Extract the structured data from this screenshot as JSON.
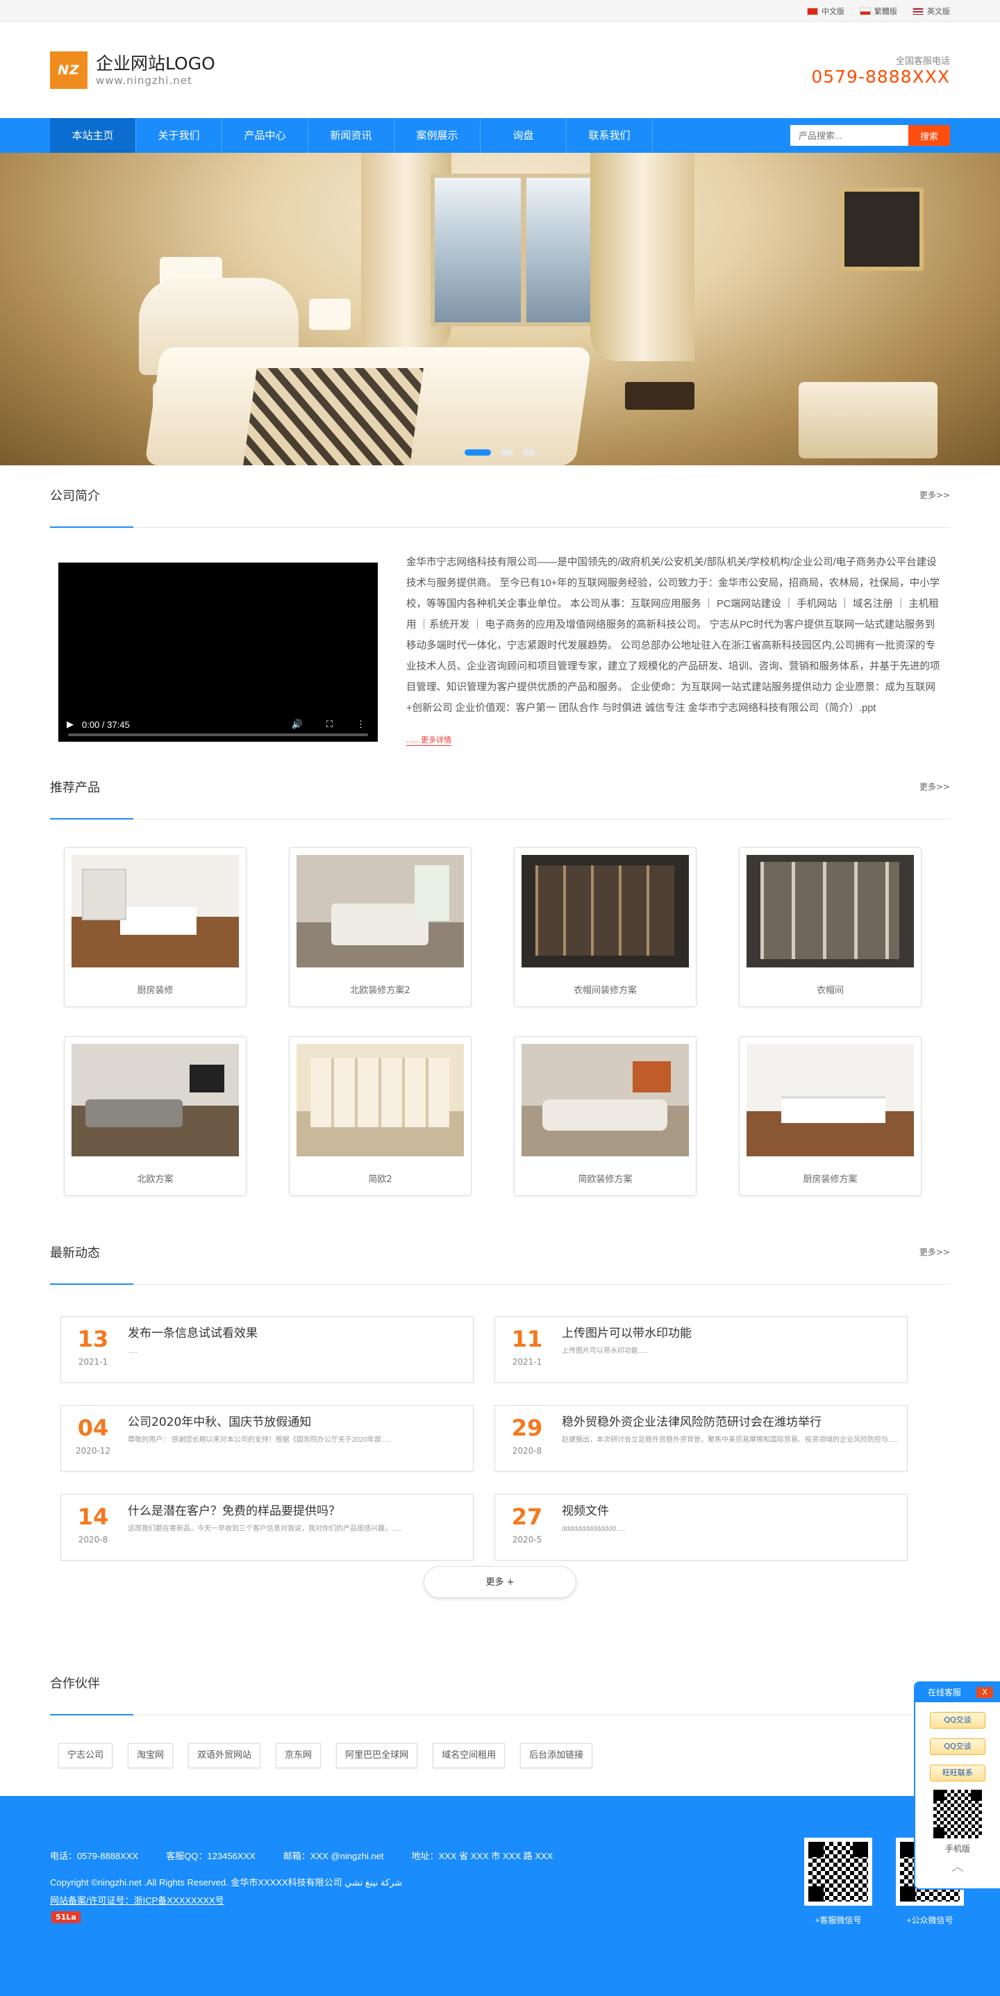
{
  "topbar": {
    "langs": [
      "中文版",
      "繁體版",
      "英文版"
    ]
  },
  "header": {
    "logo_mark": "NZ",
    "logo_title": "企业网站LOGO",
    "logo_sub": "www.ningzhi.net",
    "hotline_label": "全国客服电话",
    "hotline": "0579-8888XXX"
  },
  "nav": {
    "items": [
      "本站主页",
      "关于我们",
      "产品中心",
      "新闻资讯",
      "案例展示",
      "询盘",
      "联系我们"
    ],
    "search_placeholder": "产品搜索...",
    "search_button": "搜索"
  },
  "about": {
    "title": "公司简介",
    "more": "更多>>",
    "video_time": "0:00 / 37:45",
    "text": "金华市宁志网络科技有限公司——是中国领先的/政府机关/公安机关/部队机关/学校机构/企业公司/电子商务办公平台建设技术与服务提供商。 至今已有10+年的互联网服务经验，公司致力于：金华市公安局，招商局，农林局，社保局，中小学校，等等国内各种机关企事业单位。 本公司从事：互联网应用服务 ｜ PC端网站建设 ｜ 手机网站 ｜ 域名注册 ｜ 主机租用 ｜系统开发 ｜ 电子商务的应用及增值网络服务的高新科技公司。 宁志从PC时代为客户提供互联网一站式建站服务到移动多端时代一体化，宁志紧跟时代发展趋势。 公司总部办公地址驻入在浙江省高新科技园区内,公司拥有一批资深的专业技术人员、企业咨询顾问和项目管理专家，建立了规模化的产品研发、培训、咨询、营销和服务体系，并基于先进的项目管理、知识管理为客户提供优质的产品和服务。 企业使命：为互联网一站式建站服务提供动力 企业愿景：成为互联网+创新公司 企业价值观：客户第一 团队合作 与时俱进 诚信专注 金华市宁志网络科技有限公司（简介）.ppt",
    "read_more": "......更多详情"
  },
  "products": {
    "title": "推荐产品",
    "more": "更多>>",
    "items": [
      {
        "name": "厨房装修",
        "img": "kitchen"
      },
      {
        "name": "北欧装修方案2",
        "img": "bed"
      },
      {
        "name": "衣帽间装修方案",
        "img": "closet"
      },
      {
        "name": "衣帽间",
        "img": "closet2"
      },
      {
        "name": "北欧方案",
        "img": "living"
      },
      {
        "name": "简欧2",
        "img": "euro"
      },
      {
        "name": "简欧装修方案",
        "img": "euro2"
      },
      {
        "name": "厨房装修方案",
        "img": "kitchen2"
      }
    ]
  },
  "news": {
    "title": "最新动态",
    "more": "更多>>",
    "more_button": "更多 +",
    "items": [
      {
        "day": "13",
        "ym": "2021-1",
        "title": "发布一条信息试试看效果",
        "desc": "....."
      },
      {
        "day": "11",
        "ym": "2021-1",
        "title": "上传图片可以带水印功能",
        "desc": "上传图片可以带水印功能....."
      },
      {
        "day": "04",
        "ym": "2020-12",
        "title": "公司2020年中秋、国庆节放假通知",
        "desc": "尊敬的用户：        感谢您长期以来对本公司的支持！根据《国务院办公厅关于2020年部....."
      },
      {
        "day": "29",
        "ym": "2020-8",
        "title": "稳外贸稳外资企业法律风险防范研讨会在潍坊举行",
        "desc": "赵健报出，本次研讨会立足稳外贸稳外资背景，聚焦中美贸易摩擦和国际贸易、投资领域的企业风险防控与....."
      },
      {
        "day": "14",
        "ym": "2020-8",
        "title": "什么是潜在客户？免费的样品要提供吗？",
        "desc": "这周我们都在寄新品，今天一早收到三个客户信息对我说，我对你们的产品很感兴趣，....."
      },
      {
        "day": "27",
        "ym": "2020-5",
        "title": "视频文件",
        "desc": "dddddddddddddd....."
      }
    ]
  },
  "partners": {
    "title": "合作伙伴",
    "items": [
      "宁志公司",
      "淘宝网",
      "双语外贸网站",
      "京东网",
      "阿里巴巴全球网",
      "域名空间租用",
      "后台添加链接"
    ]
  },
  "footer": {
    "phone": "电话：0579-8888XXX",
    "qq": "客服QQ：123456XXX",
    "email": "邮箱：XXX @ningzhi.net",
    "address": "地址：XXX 省 XXX 市 XXX 路 XXX",
    "copyright": "Copyright ©ningzhi.net .All Rights Reserved. 金华市XXXXX科技有限公司 شركة نينغ تشي",
    "beian": "网站备案/许可证号：浙ICP备XXXXXXXX号",
    "stat": "51La",
    "qr1_caption": "+客服微信号",
    "qr2_caption": "+公众微信号"
  },
  "kefu": {
    "title": "在线客服",
    "close": "X",
    "btn1": "QQ交谈",
    "btn2": "QQ交谈",
    "btn3": "旺旺联系",
    "mobile": "手机版",
    "top": "︿"
  },
  "colors": {
    "primary": "#1a8cfc",
    "accent": "#ff4d00",
    "date": "#f5781e"
  }
}
